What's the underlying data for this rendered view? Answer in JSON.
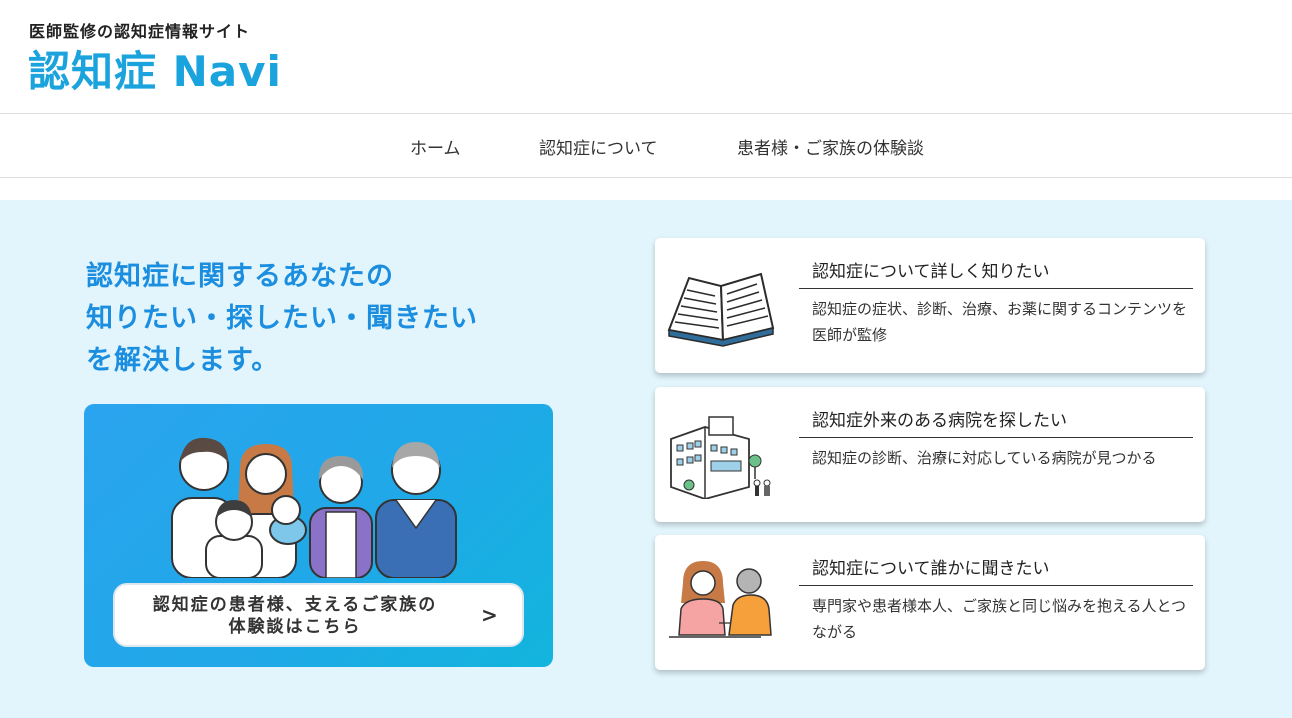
{
  "header": {
    "tagline": "医師監修の認知症情報サイト",
    "logo": "認知症 Navi"
  },
  "nav": {
    "items": [
      {
        "label": "ホーム"
      },
      {
        "label": "認知症について"
      },
      {
        "label": "患者様・ご家族の体験談"
      }
    ]
  },
  "hero": {
    "headline": [
      "認知症に関するあなたの",
      "知りたい・探したい・聞きたい",
      "を解決します。"
    ],
    "banner": {
      "button_lines": [
        "認知症の患者様、支えるご家族の",
        "体験談はこちら"
      ],
      "chevron": ">",
      "illustration": "family-illustration"
    }
  },
  "cards": [
    {
      "title": "認知症について詳しく知りたい",
      "desc": "認知症の症状、診断、治療、お薬に関するコンテンツを医師が監修",
      "icon": "open-book-icon"
    },
    {
      "title": "認知症外来のある病院を探したい",
      "desc": "認知症の診断、治療に対応している病院が見つかる",
      "icon": "hospital-icon"
    },
    {
      "title": "認知症について誰かに聞きたい",
      "desc": "専門家や患者様本人、ご家族と同じ悩みを抱える人とつながる",
      "icon": "conversation-icon"
    }
  ],
  "colors": {
    "brand": "#1aa3dc",
    "headline": "#1c8ee0",
    "hero_bg": "#e2f5fc"
  }
}
